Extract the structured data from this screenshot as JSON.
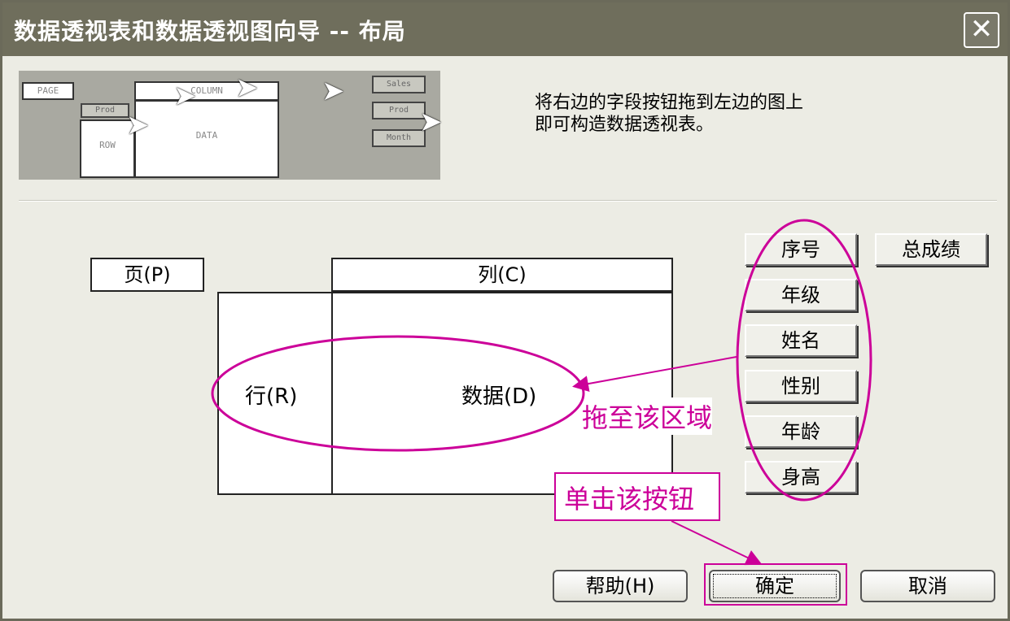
{
  "window": {
    "title": "数据透视表和数据透视图向导 -- 布局",
    "close_glyph": "✕"
  },
  "preview": {
    "page_label": "PAGE",
    "row_label": "ROW",
    "column_label": "COLUMN",
    "data_label": "DATA",
    "field_label": "Prod",
    "buttons": [
      "Sales",
      "Prod",
      "Month"
    ]
  },
  "instructions": "将右边的字段按钮拖到左边的图上\n即可构造数据透视表。",
  "layout": {
    "page": "页(P)",
    "column": "列(C)",
    "row": "行(R)",
    "data": "数据(D)"
  },
  "fields": [
    "序号",
    "总成绩",
    "年级",
    "姓名",
    "性别",
    "年龄",
    "身高"
  ],
  "annotations": {
    "drag_here": "拖至该区域",
    "click_button": "单击该按钮",
    "color": "#cc0099"
  },
  "buttons": {
    "help": "帮助(H)",
    "ok": "确定",
    "cancel": "取消"
  }
}
